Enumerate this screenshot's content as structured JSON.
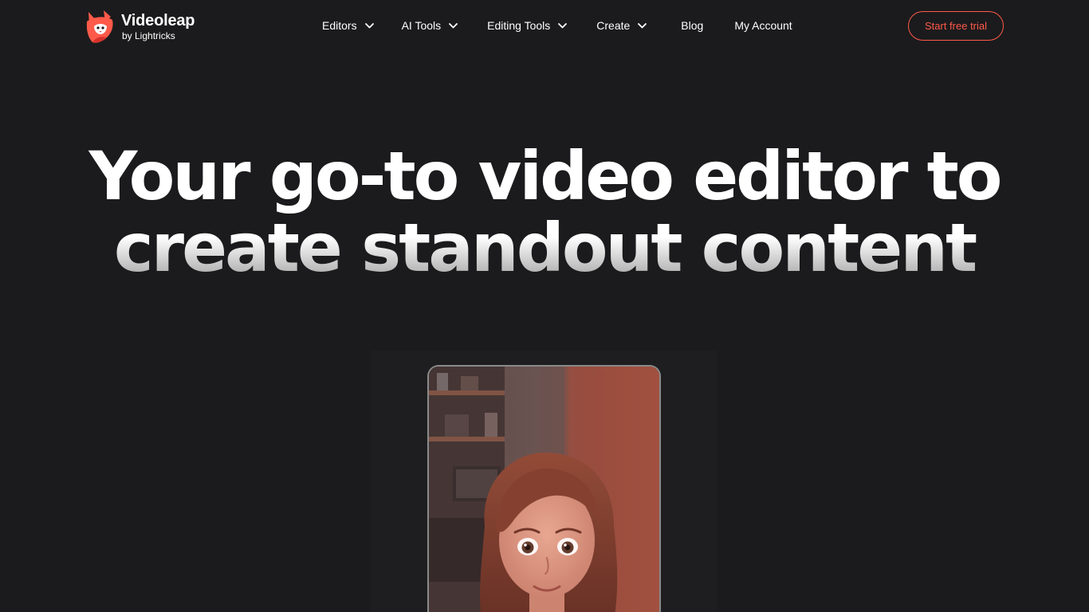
{
  "brand": {
    "name": "Videoleap",
    "sub": "by Lightricks",
    "logo_icon": "videoleap-fox-logo-icon",
    "accent_color": "#ff5a4a"
  },
  "nav": {
    "items": [
      {
        "label": "Editors",
        "has_dropdown": true,
        "icon": "chevron-down-icon"
      },
      {
        "label": "AI Tools",
        "has_dropdown": true,
        "icon": "chevron-down-icon"
      },
      {
        "label": "Editing Tools",
        "has_dropdown": true,
        "icon": "chevron-down-icon"
      },
      {
        "label": "Create",
        "has_dropdown": true,
        "icon": "chevron-down-icon"
      },
      {
        "label": "Blog",
        "has_dropdown": false
      },
      {
        "label": "My Account",
        "has_dropdown": false
      }
    ],
    "cta_label": "Start free trial"
  },
  "hero": {
    "line1": "Your go-to video editor to",
    "line2": "create standout content"
  },
  "preview": {
    "image": "animated-avatar-woman-preview"
  },
  "colors": {
    "background": "#1b1b1d",
    "text": "#ffffff"
  }
}
